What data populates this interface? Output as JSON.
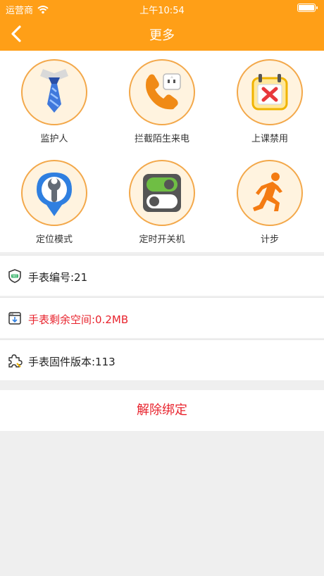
{
  "status_bar": {
    "carrier": "运营商",
    "time": "上午10:54"
  },
  "nav": {
    "title": "更多"
  },
  "features": [
    {
      "label": "监护人",
      "icon": "tie-icon"
    },
    {
      "label": "拦截陌生来电",
      "icon": "phone-block-icon"
    },
    {
      "label": "上课禁用",
      "icon": "calendar-x-icon"
    },
    {
      "label": "定位模式",
      "icon": "location-wrench-icon"
    },
    {
      "label": "定时开关机",
      "icon": "toggle-switch-icon"
    },
    {
      "label": "计步",
      "icon": "runner-icon"
    }
  ],
  "info": {
    "watch_number": "手表编号:21",
    "remaining_space": "手表剩余空间:0.2MB",
    "firmware": "手表固件版本:113"
  },
  "unbind_label": "解除绑定",
  "colors": {
    "header": "#ff9f17",
    "accent_red": "#e8232d",
    "icon_border": "#f3a84a"
  }
}
